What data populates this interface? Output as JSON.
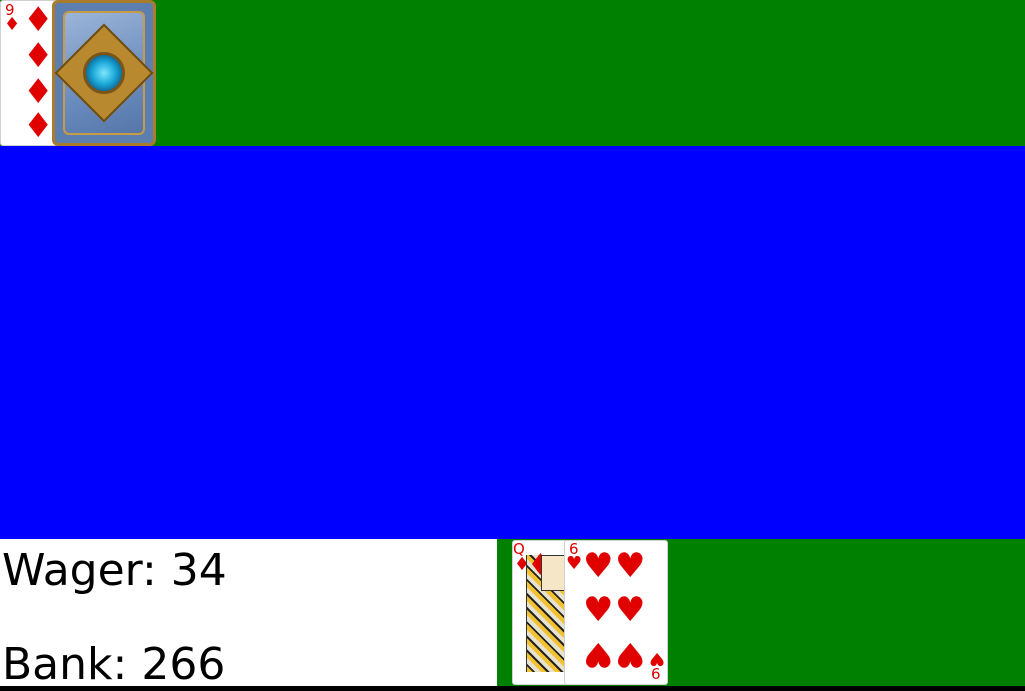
{
  "dealer": {
    "cards": [
      {
        "rank": "9",
        "suit": "♦",
        "face_up": true
      },
      {
        "face_up": false,
        "back": "hearthstone-card-back"
      }
    ]
  },
  "player": {
    "cards": [
      {
        "rank": "Q",
        "suit": "♦"
      },
      {
        "rank": "6",
        "suit": "♥"
      }
    ]
  },
  "info": {
    "wager_label": "Wager: 34",
    "bank_label": "Bank: 266"
  },
  "colors": {
    "felt": "#008000",
    "table_mid": "#0000ff",
    "suit_red": "#e00000"
  }
}
